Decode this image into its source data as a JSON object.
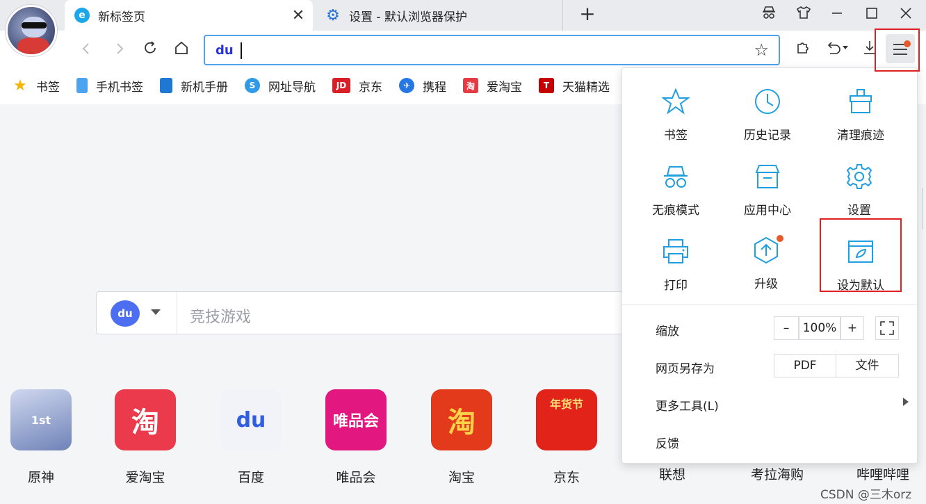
{
  "tabs": [
    {
      "title": "新标签页",
      "icon": "ie-e-icon",
      "close": "✕"
    },
    {
      "title": "设置 - 默认浏览器保护",
      "icon": "gear-icon"
    }
  ],
  "new_tab_symbol": "+",
  "address_bar": {
    "value": "",
    "engine": "du"
  },
  "bookmarks": [
    {
      "label": "书签",
      "icon": "star-icon",
      "color": "#f4b400",
      "glyph": "★"
    },
    {
      "label": "手机书签",
      "icon": "phone-icon",
      "color": "#4da3ee",
      "glyph": ""
    },
    {
      "label": "新机手册",
      "icon": "book-icon",
      "color": "#1f78d1",
      "glyph": ""
    },
    {
      "label": "网址导航",
      "icon": "nav-icon",
      "color": "#2f9be8",
      "glyph": "S"
    },
    {
      "label": "京东",
      "icon": "jd-icon",
      "color": "#d91e26",
      "glyph": "JD"
    },
    {
      "label": "携程",
      "icon": "ctrip-icon",
      "color": "#2577e3",
      "glyph": "✈"
    },
    {
      "label": "爱淘宝",
      "icon": "aitaobao-icon",
      "color": "#e53b45",
      "glyph": "淘"
    },
    {
      "label": "天猫精选",
      "icon": "tmall-icon",
      "color": "#c40000",
      "glyph": "T"
    }
  ],
  "search": {
    "engine": "du",
    "placeholder": "竞技游戏"
  },
  "apps": [
    {
      "label": "原神",
      "glyph": "1st",
      "color": "#8a9bc7"
    },
    {
      "label": "爱淘宝",
      "glyph": "淘",
      "color": "#ea3a4b"
    },
    {
      "label": "百度",
      "glyph": "du",
      "color": "#f1f3f8"
    },
    {
      "label": "唯品会",
      "glyph": "唯品会",
      "color": "#e2177f"
    },
    {
      "label": "淘宝",
      "glyph": "淘",
      "color": "#e33a1c"
    },
    {
      "label": "京东",
      "glyph": "年货节",
      "color": "#e2231a"
    },
    {
      "label": "联想"
    },
    {
      "label": "考拉海购"
    },
    {
      "label": "哔哩哔哩"
    }
  ],
  "menu": {
    "grid": [
      {
        "label": "书签",
        "icon": "star-outline-icon",
        "glyph": "☆"
      },
      {
        "label": "历史记录",
        "icon": "clock-icon",
        "glyph": "◷"
      },
      {
        "label": "清理痕迹",
        "icon": "broom-icon",
        "glyph": "⌂"
      },
      {
        "label": "无痕模式",
        "icon": "incognito-icon",
        "glyph": "ꝏ"
      },
      {
        "label": "应用中心",
        "icon": "store-icon",
        "glyph": "⌸"
      },
      {
        "label": "设置",
        "icon": "gear-outline-icon",
        "glyph": "⚙"
      },
      {
        "label": "打印",
        "icon": "printer-icon",
        "glyph": "⎙"
      },
      {
        "label": "升级",
        "icon": "upgrade-icon",
        "glyph": "⬡"
      },
      {
        "label": "设为默认",
        "icon": "default-browser-icon",
        "glyph": "▭"
      }
    ],
    "zoom_label": "缩放",
    "zoom_minus": "–",
    "zoom_value": "100%",
    "zoom_plus": "+",
    "save_as_label": "网页另存为",
    "save_pdf": "PDF",
    "save_file": "文件",
    "more_tools": "更多工具(L)",
    "feedback": "反馈"
  },
  "watermark": "CSDN @三木orz",
  "colors": {
    "accent": "#1f9fe0",
    "highlight": "#e02020",
    "badge": "#e55a2b"
  }
}
